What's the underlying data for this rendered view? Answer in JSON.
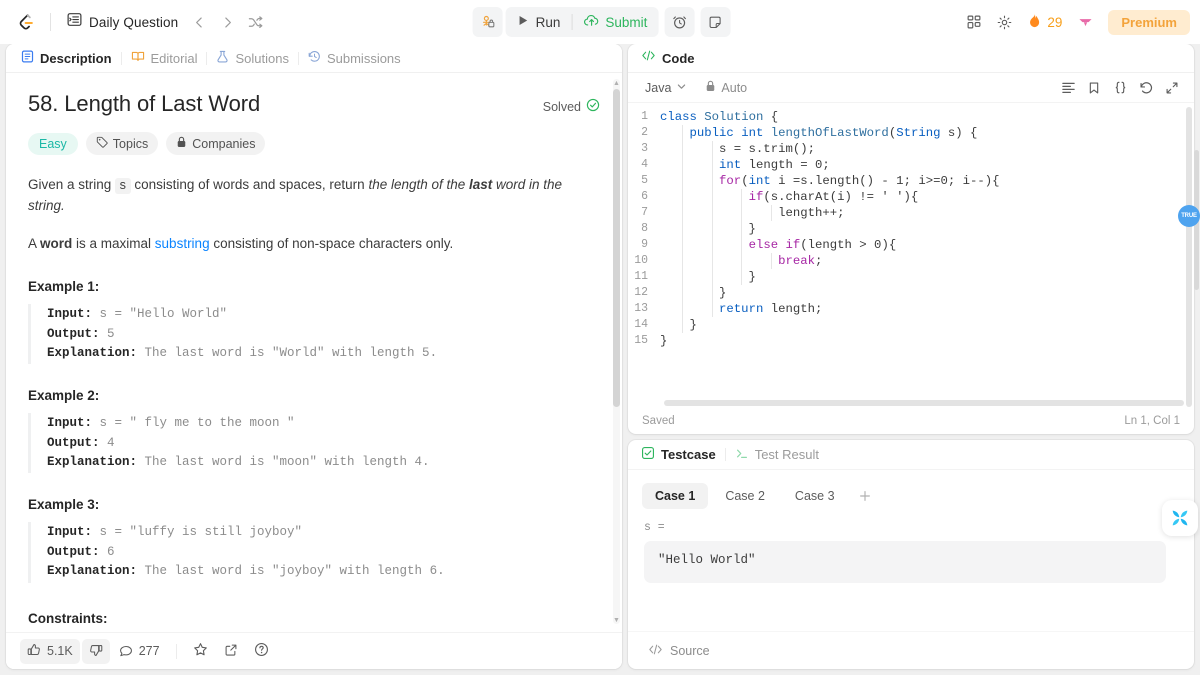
{
  "navbar": {
    "logo_icon": "leetcode-logo-icon",
    "daily_question": "Daily Question",
    "list_icon": "list-icon",
    "prev_icon": "chevron-left-icon",
    "next_icon": "chevron-right-icon",
    "shuffle_icon": "shuffle-icon",
    "debug_icon": "debug-lock-icon",
    "run_label": "Run",
    "run_icon": "play-icon",
    "submit_label": "Submit",
    "submit_icon": "cloud-upload-icon",
    "timer_icon": "timer-icon",
    "note_icon": "note-icon",
    "apps_icon": "grid-apps-icon",
    "settings_icon": "gear-icon",
    "streak_icon": "flame-icon",
    "streak_count": "29",
    "avatar_icon": "user-avatar-icon",
    "premium_label": "Premium"
  },
  "left": {
    "tabs": [
      {
        "label": "Description",
        "icon": "document-icon",
        "active": true
      },
      {
        "label": "Editorial",
        "icon": "book-icon",
        "active": false
      },
      {
        "label": "Solutions",
        "icon": "flask-icon",
        "active": false
      },
      {
        "label": "Submissions",
        "icon": "history-icon",
        "active": false
      }
    ],
    "title": "58. Length of Last Word",
    "solved_label": "Solved",
    "solved_icon": "check-circle-icon",
    "badges": [
      {
        "label": "Easy",
        "icon": ""
      },
      {
        "label": "Topics",
        "icon": "tag-icon"
      },
      {
        "label": "Companies",
        "icon": "lock-icon"
      }
    ],
    "description": {
      "p1_a": "Given a string ",
      "p1_code": "s",
      "p1_b": " consisting of words and spaces, return ",
      "p1_italic_a": "the length of the ",
      "p1_italic_bold": "last",
      "p1_italic_b": " word in the string.",
      "p2_a": "A ",
      "p2_bold": "word",
      "p2_b": " is a maximal ",
      "p2_link": "substring",
      "p2_c": " consisting of non-space characters only."
    },
    "examples": [
      {
        "heading": "Example 1:",
        "input_label": "Input:",
        "input_value": " s = \"Hello World\"",
        "output_label": "Output:",
        "output_value": " 5",
        "explanation_label": "Explanation:",
        "explanation_value": " The last word is \"World\" with length 5."
      },
      {
        "heading": "Example 2:",
        "input_label": "Input:",
        "input_value": " s = \"   fly me   to   the moon  \"",
        "output_label": "Output:",
        "output_value": " 4",
        "explanation_label": "Explanation:",
        "explanation_value": " The last word is \"moon\" with length 4."
      },
      {
        "heading": "Example 3:",
        "input_label": "Input:",
        "input_value": " s = \"luffy is still joyboy\"",
        "output_label": "Output:",
        "output_value": " 6",
        "explanation_label": "Explanation:",
        "explanation_value": " The last word is \"joyboy\" with length 6."
      }
    ],
    "constraints_heading": "Constraints:",
    "footer": {
      "like_icon": "thumbs-up-icon",
      "like_count": "5.1K",
      "dislike_icon": "thumbs-down-icon",
      "comment_icon": "comment-icon",
      "comment_count": "277",
      "star_icon": "star-icon",
      "share_icon": "share-icon",
      "help_icon": "question-circle-icon"
    }
  },
  "code": {
    "panel_title": "Code",
    "panel_icon": "code-brackets-icon",
    "language": "Java",
    "language_chevron": "chevron-down-icon",
    "auto_label": "Auto",
    "auto_icon": "lock-icon",
    "toolbar_icons": [
      "format-lines-icon",
      "bookmark-icon",
      "curly-braces-icon",
      "undo-icon",
      "expand-icon"
    ],
    "lines": [
      {
        "n": "1",
        "text": "class Solution {"
      },
      {
        "n": "2",
        "text": "    public int lengthOfLastWord(String s) {"
      },
      {
        "n": "3",
        "text": "        s = s.trim();"
      },
      {
        "n": "4",
        "text": "        int length = 0;"
      },
      {
        "n": "5",
        "text": "        for(int i =s.length() - 1; i>=0; i--){"
      },
      {
        "n": "6",
        "text": "            if(s.charAt(i) != ' '){"
      },
      {
        "n": "7",
        "text": "                length++;"
      },
      {
        "n": "8",
        "text": "            }"
      },
      {
        "n": "9",
        "text": "            else if(length > 0){"
      },
      {
        "n": "10",
        "text": "                break;"
      },
      {
        "n": "11",
        "text": "            }"
      },
      {
        "n": "12",
        "text": "        }"
      },
      {
        "n": "13",
        "text": "        return length;"
      },
      {
        "n": "14",
        "text": "    }"
      },
      {
        "n": "15",
        "text": "}"
      }
    ],
    "status_left": "Saved",
    "status_right": "Ln 1, Col 1"
  },
  "test": {
    "tabs": [
      {
        "label": "Testcase",
        "icon": "checkbox-icon",
        "active": true
      },
      {
        "label": "Test Result",
        "icon": "terminal-icon",
        "active": false
      }
    ],
    "cases": [
      {
        "label": "Case 1",
        "active": true
      },
      {
        "label": "Case 2",
        "active": false
      },
      {
        "label": "Case 3",
        "active": false
      }
    ],
    "add_case_icon": "plus-icon",
    "variable_label": "s =",
    "variable_value": "\"Hello World\"",
    "source_label": "Source",
    "source_icon": "code-brackets-icon"
  },
  "floating": {
    "badge_text": "TRUE",
    "x_icon": "butterfly-x-icon"
  },
  "colors": {
    "accent_green": "#2db55d",
    "easy_teal": "#1cb8a6",
    "premium_orange": "#f3a33b",
    "link_blue": "#0a84ff"
  }
}
